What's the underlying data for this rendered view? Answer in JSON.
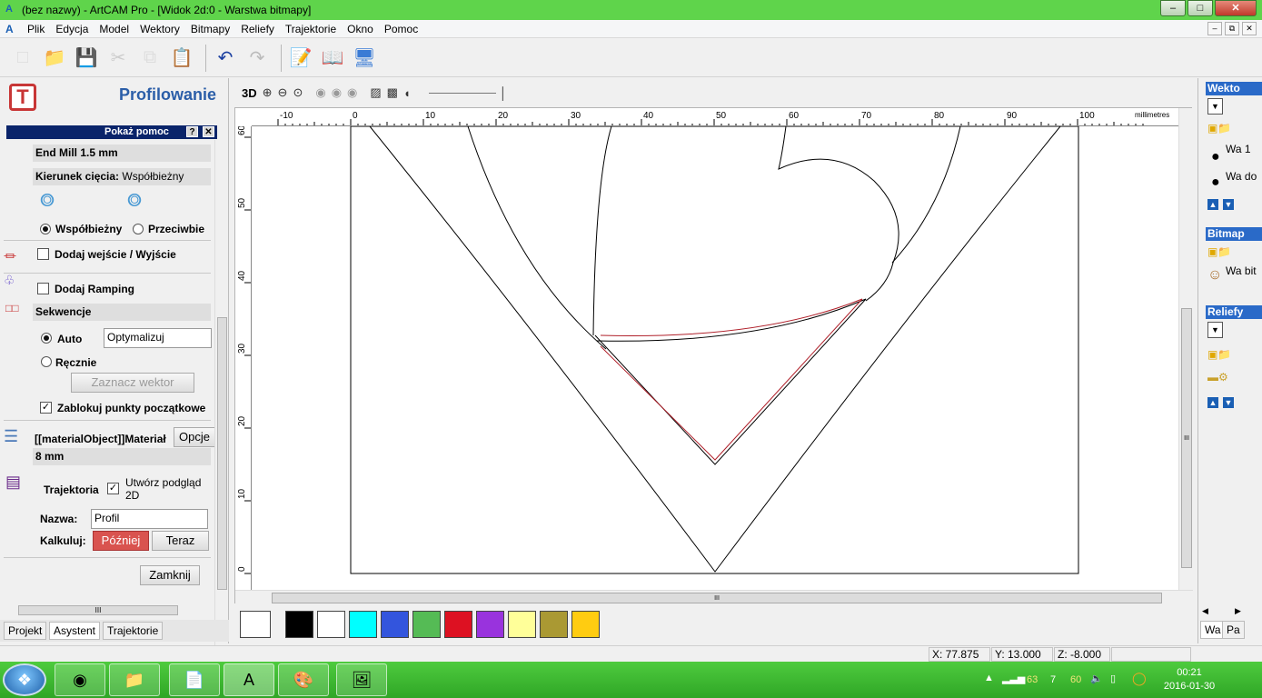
{
  "window": {
    "title": "(bez nazwy) - ArtCAM Pro - [Widok 2d:0 - Warstwa bitmapy]",
    "minimize": "–",
    "maximize": "□",
    "close": "✕"
  },
  "menu": {
    "items": [
      "Plik",
      "Edycja",
      "Model",
      "Wektory",
      "Bitmapy",
      "Reliefy",
      "Trajektorie",
      "Okno",
      "Pomoc"
    ],
    "mdi": [
      "–",
      "⧉",
      "✕"
    ]
  },
  "toolbar": {
    "icons": [
      "new-file-icon",
      "open-folder-icon",
      "save-icon",
      "cut-icon",
      "copy-icon",
      "paste-icon",
      "undo-icon",
      "redo-icon",
      "notes-icon",
      "book-icon",
      "wizard-icon"
    ]
  },
  "left_panel": {
    "title": "Profilowanie",
    "help_bar": "Pokaż pomoc",
    "help_q": "?",
    "help_x": "✕",
    "tool": "End Mill 1.5 mm",
    "cut_direction_label": "Kierunek cięcia:",
    "cut_direction_value": "Współbieżny",
    "radio_climb": "Współbieżny",
    "radio_conventional": "Przeciwbie",
    "add_lead": "Dodaj wejście / Wyjście",
    "add_ramping": "Dodaj Ramping",
    "sequences": "Sekwencje",
    "auto": "Auto",
    "optimize": "Optymalizuj",
    "manual": "Ręcznie",
    "select_vector": "Zaznacz wektor",
    "lock_start": "Zablokuj punkty początkowe",
    "material": "[[materialObject]]Materiał",
    "options": "Opcje",
    "material_thickness": "8 mm",
    "toolpath": "Trajektoria",
    "create_preview": "Utwórz podgląd 2D",
    "name_label": "Nazwa:",
    "name_value": "Profil",
    "calc_label": "Kalkuluj:",
    "later": "Później",
    "now": "Teraz",
    "close": "Zamknij",
    "scroll_grip": "III",
    "tabs": [
      "Projekt",
      "Asystent",
      "Trajektorie"
    ]
  },
  "canvas": {
    "toolbar_3d": "3D",
    "units": "millimetres",
    "h_ticks": [
      -10,
      0,
      10,
      20,
      30,
      40,
      50,
      60,
      70,
      80,
      90,
      100
    ],
    "v_ticks": [
      60,
      50,
      40,
      30,
      20,
      10,
      0
    ],
    "hscroll_grip": "III",
    "vscroll_grip": "III"
  },
  "palette": {
    "colors": [
      "#000000",
      "#ffffff",
      "#00ffff",
      "#3355dd",
      "#55bb55",
      "#dd1122",
      "#9933dd",
      "#ffff99",
      "#aa9933",
      "#ffcc11"
    ]
  },
  "right_panel": {
    "vectors_head": "Wekto",
    "layers": [
      "Wa 1",
      "Wa do"
    ],
    "bitmaps_head": "Bitmap",
    "bitmap_layer": "Wa bit",
    "reliefs_head": "Reliefy",
    "tabs": [
      "Wa",
      "Pa"
    ]
  },
  "status": {
    "x": "X: 77.875",
    "y": "Y: 13.000",
    "z": "Z: -8.000"
  },
  "taskbar": {
    "tray_nums": [
      "63",
      "7",
      "60"
    ],
    "time": "00:21",
    "date": "2016-01-30"
  }
}
